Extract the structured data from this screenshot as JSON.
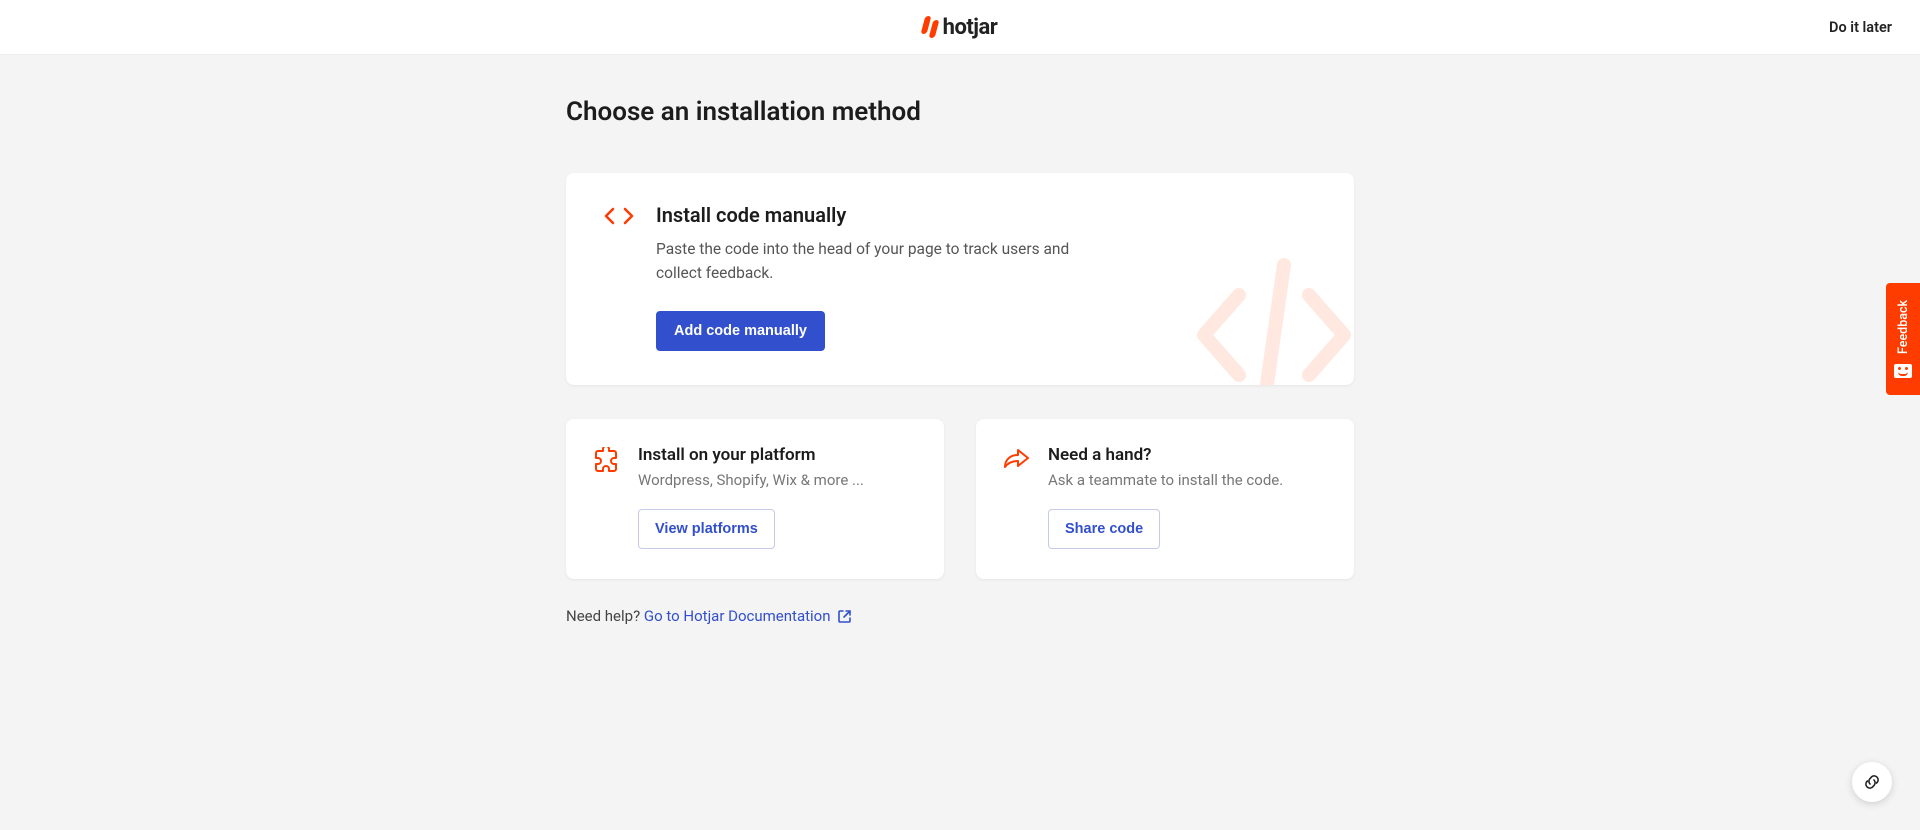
{
  "header": {
    "logo_text": "hotjar",
    "do_later": "Do it later"
  },
  "page": {
    "title": "Choose an installation method"
  },
  "main_card": {
    "title": "Install code manually",
    "description": "Paste the code into the head of your page to track users and collect feedback.",
    "button": "Add code manually"
  },
  "platform_card": {
    "title": "Install on your platform",
    "description": "Wordpress, Shopify, Wix & more ...",
    "button": "View platforms"
  },
  "help_card": {
    "title": "Need a hand?",
    "description": "Ask a teammate to install the code.",
    "button": "Share code"
  },
  "help_line": {
    "prefix": "Need help? ",
    "link_text": "Go to Hotjar Documentation"
  },
  "feedback": {
    "label": "Feedback"
  }
}
